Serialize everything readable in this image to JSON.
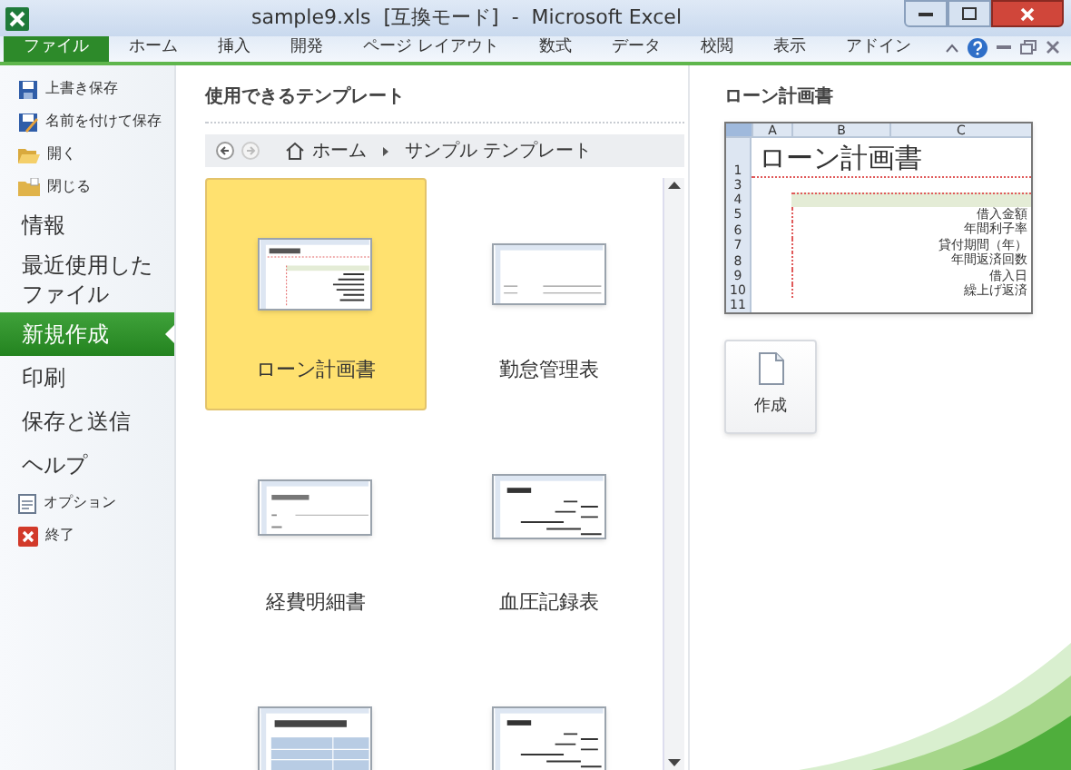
{
  "window": {
    "title": "sample9.xls  [互換モード]  -  Microsoft Excel"
  },
  "tabs": [
    {
      "label": "ファイル",
      "selected": true
    },
    {
      "label": "ホーム",
      "selected": false
    },
    {
      "label": "挿入",
      "selected": false
    },
    {
      "label": "開発",
      "selected": false
    },
    {
      "label": "ページ レイアウト",
      "selected": false
    },
    {
      "label": "数式",
      "selected": false
    },
    {
      "label": "データ",
      "selected": false
    },
    {
      "label": "校閲",
      "selected": false
    },
    {
      "label": "表示",
      "selected": false
    },
    {
      "label": "アドイン",
      "selected": false
    }
  ],
  "sidebar": {
    "items": [
      {
        "kind": "command",
        "label": "上書き保存",
        "selected": false
      },
      {
        "kind": "command",
        "label": "名前を付けて保存",
        "selected": false
      },
      {
        "kind": "command",
        "label": "開く",
        "selected": false
      },
      {
        "kind": "command",
        "label": "閉じる",
        "selected": false
      },
      {
        "kind": "section",
        "label": "情報",
        "selected": false
      },
      {
        "kind": "section",
        "label": "最近使用したファイル",
        "selected": false
      },
      {
        "kind": "section",
        "label": "新規作成",
        "selected": true
      },
      {
        "kind": "section",
        "label": "印刷",
        "selected": false
      },
      {
        "kind": "section",
        "label": "保存と送信",
        "selected": false
      },
      {
        "kind": "section",
        "label": "ヘルプ",
        "selected": false
      },
      {
        "kind": "command",
        "label": "オプション",
        "selected": false
      },
      {
        "kind": "command",
        "label": "終了",
        "selected": false
      }
    ]
  },
  "gallery": {
    "heading": "使用できるテンプレート",
    "breadcrumb": [
      "ホーム",
      "サンプル テンプレート"
    ],
    "templates": [
      {
        "name": "ローン計画書",
        "selected": true
      },
      {
        "name": "勤怠管理表",
        "selected": false
      },
      {
        "name": "経費明細書",
        "selected": false
      },
      {
        "name": "血圧記録表",
        "selected": false
      },
      {
        "selected": false
      },
      {
        "selected": false
      }
    ]
  },
  "preview": {
    "heading": "ローン計画書",
    "columns": [
      "A",
      "B",
      "C"
    ],
    "title": "ローン計画書",
    "rows": [
      {
        "num": "1"
      },
      {
        "num": "3"
      },
      {
        "num": "4"
      },
      {
        "num": "5",
        "label": "借入金額"
      },
      {
        "num": "6",
        "label": "年間利子率"
      },
      {
        "num": "7",
        "label": "貸付期間（年）"
      },
      {
        "num": "8",
        "label": "年間返済回数"
      },
      {
        "num": "9",
        "label": "借入日"
      },
      {
        "num": "10",
        "label": "繰上げ返済"
      },
      {
        "num": "11"
      }
    ],
    "create_button": "作成"
  }
}
